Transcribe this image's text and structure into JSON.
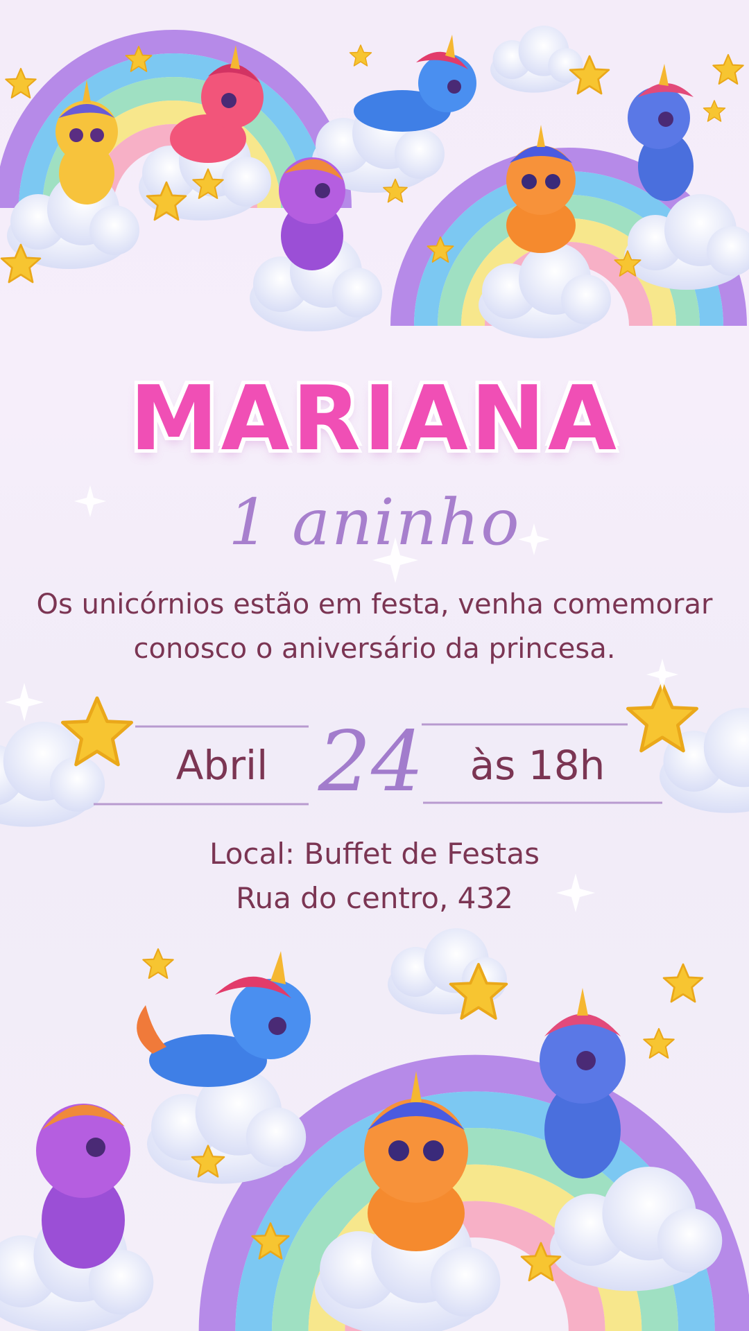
{
  "invitation": {
    "name": "MARIANA",
    "age": "1 aninho",
    "message_line1": "Os unicórnios estão  em festa, venha comemorar",
    "message_line2": "conosco o  aniversário da princesa.",
    "month": "Abril",
    "day": "24",
    "time": "às 18h",
    "venue_line1": "Local: Buffet de Festas",
    "venue_line2": "Rua do centro, 432"
  },
  "colors": {
    "title": "#f04fb5",
    "accent_lilac": "#a77fcd",
    "text_wine": "#7b3553",
    "star": "#f7c531",
    "cloud": "#e8ecfb"
  },
  "decorations": {
    "icons": [
      "unicorn-icon",
      "rainbow-icon",
      "cloud-icon",
      "star-icon",
      "sparkle-icon"
    ]
  }
}
